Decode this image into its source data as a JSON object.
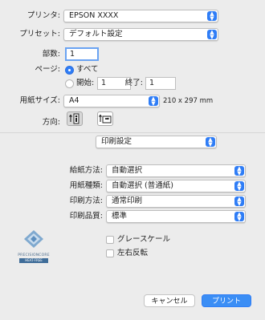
{
  "printer": {
    "label": "プリンタ:",
    "value": "EPSON XXXX"
  },
  "preset": {
    "label": "プリセット:",
    "value": "デフォルト設定"
  },
  "copies": {
    "label": "部数:",
    "value": "1"
  },
  "pages": {
    "label": "ページ:",
    "all_label": "すべて",
    "from_label": "開始:",
    "from_value": "1",
    "to_label": "終了:",
    "to_value": "1",
    "selected": "all"
  },
  "paper_size": {
    "label": "用紙サイズ:",
    "value": "A4",
    "dimensions": "210 x 297 mm"
  },
  "orientation": {
    "label": "方向:",
    "selected": "portrait",
    "portrait_icon": "portrait-person-icon",
    "landscape_icon": "landscape-person-icon"
  },
  "section": {
    "value": "印刷設定"
  },
  "settings": [
    {
      "label": "給紙方法:",
      "value": "自動選択"
    },
    {
      "label": "用紙種類:",
      "value": "自動選択 (普通紙)"
    },
    {
      "label": "印刷方法:",
      "value": "通常印刷"
    },
    {
      "label": "印刷品質:",
      "value": "標準"
    }
  ],
  "options": [
    {
      "label": "グレースケール",
      "checked": false
    },
    {
      "label": "左右反転",
      "checked": false
    }
  ],
  "logo": {
    "line1": "PRECISIONCORE",
    "line2": "HEAT-FREE"
  },
  "buttons": {
    "cancel": "キャンセル",
    "print": "プリント"
  },
  "colors": {
    "accent": "#2f7df6",
    "background": "#ececec"
  }
}
